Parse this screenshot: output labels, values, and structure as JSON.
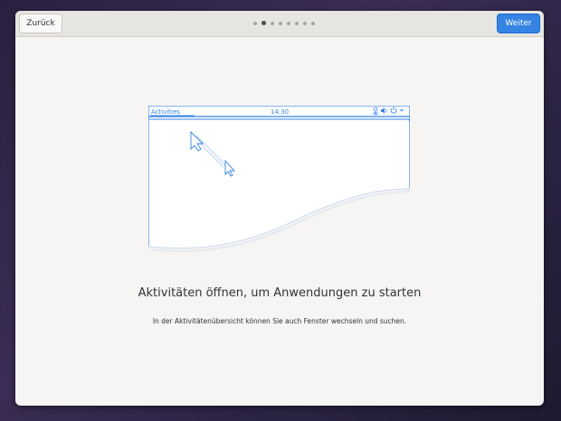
{
  "header": {
    "back_label": "Zurück",
    "next_label": "Weiter",
    "pages": {
      "total": 8,
      "current": 2
    }
  },
  "illustration": {
    "activities_label": "Activities",
    "clock": "14:30",
    "accent": "#3584e4"
  },
  "content": {
    "title": "Aktivitäten öffnen, um Anwendungen zu starten",
    "description": "In der Aktivitätenübersicht können Sie auch Fenster wechseln und suchen."
  }
}
